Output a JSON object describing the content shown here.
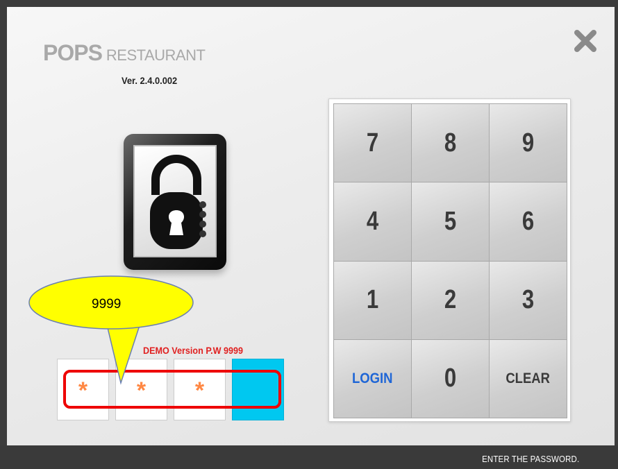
{
  "app": {
    "brand_main": "POPS",
    "brand_sub": "RESTAURANT",
    "version": "Ver. 2.4.0.002"
  },
  "close_icon": "close-x-icon",
  "lock_icon": "padlock-icon",
  "keypad": {
    "keys": [
      "7",
      "8",
      "9",
      "4",
      "5",
      "6",
      "1",
      "2",
      "3",
      "LOGIN",
      "0",
      "CLEAR"
    ]
  },
  "pin": {
    "label": "DEMO Version P.W 9999",
    "masked": [
      "*",
      "*",
      "*",
      ""
    ],
    "active_index": 3,
    "active_color": "#00c8f0",
    "mask_color": "#ff8844"
  },
  "callout": {
    "text": "9999",
    "fill": "#ffff00",
    "highlight_color": "#ee0000"
  },
  "status": {
    "message": "ENTER THE PASSWORD."
  }
}
